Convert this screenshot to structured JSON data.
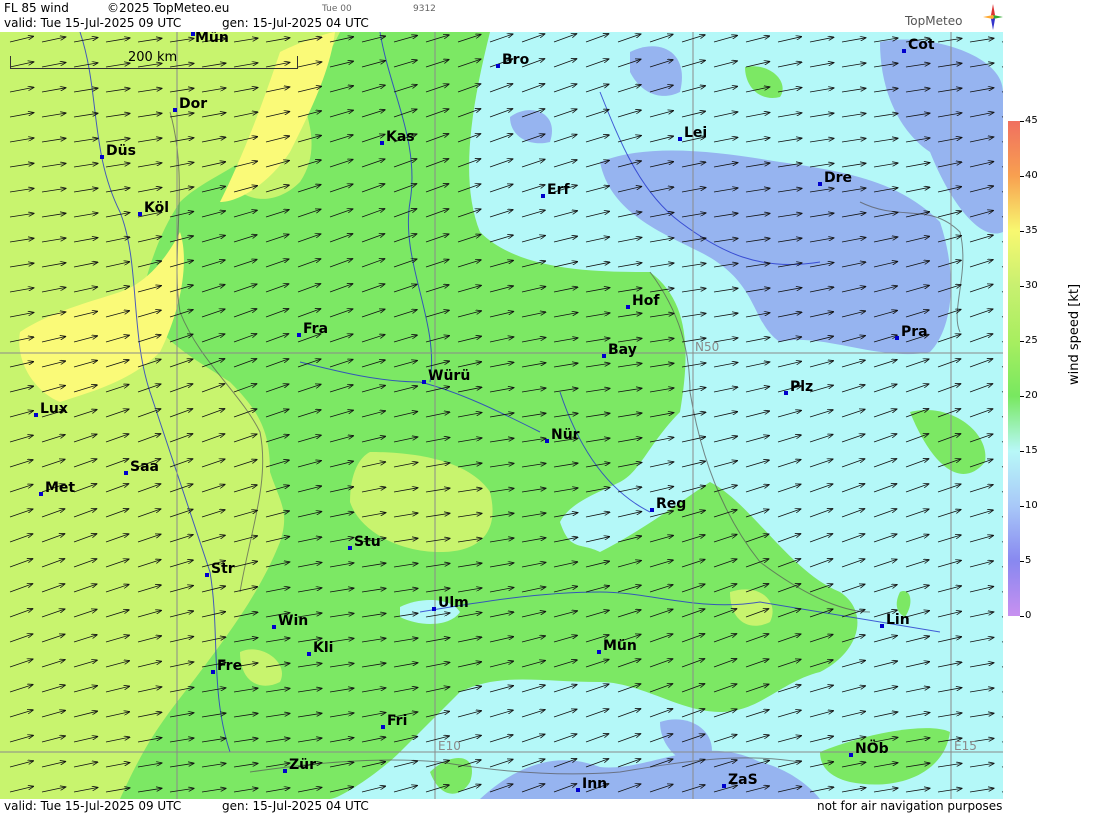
{
  "header": {
    "product": "FL 85 wind",
    "copyright": "©2025 TopMeteo.eu",
    "run_label": "Tue 00",
    "code": "9312",
    "valid": "valid:  Tue  15-Jul-2025  09 UTC",
    "gen": "gen: 15-Jul-2025 04 UTC",
    "logo_text": "TopMeteo"
  },
  "footer": {
    "valid": "valid:  Tue  15-Jul-2025  09 UTC",
    "gen": "gen: 15-Jul-2025 04 UTC",
    "disclaimer": "not for air navigation purposes"
  },
  "scale": {
    "label": "200 km"
  },
  "grid_labels": {
    "n50": "N50",
    "e10": "E10",
    "e15": "E15"
  },
  "cities": [
    {
      "name": "Mün",
      "id": "mun-top"
    },
    {
      "name": "Dor",
      "id": "dor"
    },
    {
      "name": "Düs",
      "id": "dus"
    },
    {
      "name": "Köl",
      "id": "kol"
    },
    {
      "name": "Kas",
      "id": "kas"
    },
    {
      "name": "Bro",
      "id": "bro"
    },
    {
      "name": "Lei",
      "id": "lei"
    },
    {
      "name": "Erf",
      "id": "erf"
    },
    {
      "name": "Dre",
      "id": "dre"
    },
    {
      "name": "Cot",
      "id": "cot"
    },
    {
      "name": "Fra",
      "id": "fra"
    },
    {
      "name": "Hof",
      "id": "hof"
    },
    {
      "name": "Bay",
      "id": "bay"
    },
    {
      "name": "Pra",
      "id": "pra"
    },
    {
      "name": "Würü",
      "id": "wur"
    },
    {
      "name": "Plz",
      "id": "plz"
    },
    {
      "name": "Lux",
      "id": "lux"
    },
    {
      "name": "Nür",
      "id": "nur"
    },
    {
      "name": "Saa",
      "id": "saa"
    },
    {
      "name": "Met",
      "id": "met"
    },
    {
      "name": "Reg",
      "id": "reg"
    },
    {
      "name": "Stu",
      "id": "stu"
    },
    {
      "name": "Str",
      "id": "str"
    },
    {
      "name": "Ulm",
      "id": "ulm"
    },
    {
      "name": "Lin",
      "id": "lin"
    },
    {
      "name": "Win",
      "id": "win"
    },
    {
      "name": "Kli",
      "id": "kli"
    },
    {
      "name": "Mün",
      "id": "mun"
    },
    {
      "name": "Fre",
      "id": "fre"
    },
    {
      "name": "Fri",
      "id": "fri"
    },
    {
      "name": "NÖb",
      "id": "nob"
    },
    {
      "name": "Zür",
      "id": "zur"
    },
    {
      "name": "Inn",
      "id": "inn"
    },
    {
      "name": "ZaS",
      "id": "zas"
    }
  ],
  "legend": {
    "title": "wind speed [kt]",
    "ticks": [
      "45",
      "40",
      "35",
      "30",
      "25",
      "20",
      "15",
      "10",
      "5",
      "0"
    ],
    "colors": [
      "#f07060",
      "#f8a050",
      "#f8f870",
      "#c8f070",
      "#a8ee60",
      "#78e860",
      "#b8f8f8",
      "#a8c8f8",
      "#8888f0",
      "#c890f0"
    ]
  },
  "wind_field": {
    "direction": "west-southwest to east-northeast",
    "colors": {
      "yellow": "#fafa78",
      "yellowgreen": "#c8f46e",
      "green": "#7ce864",
      "cyan": "#b4f8f8",
      "blue": "#96b4f0"
    }
  }
}
